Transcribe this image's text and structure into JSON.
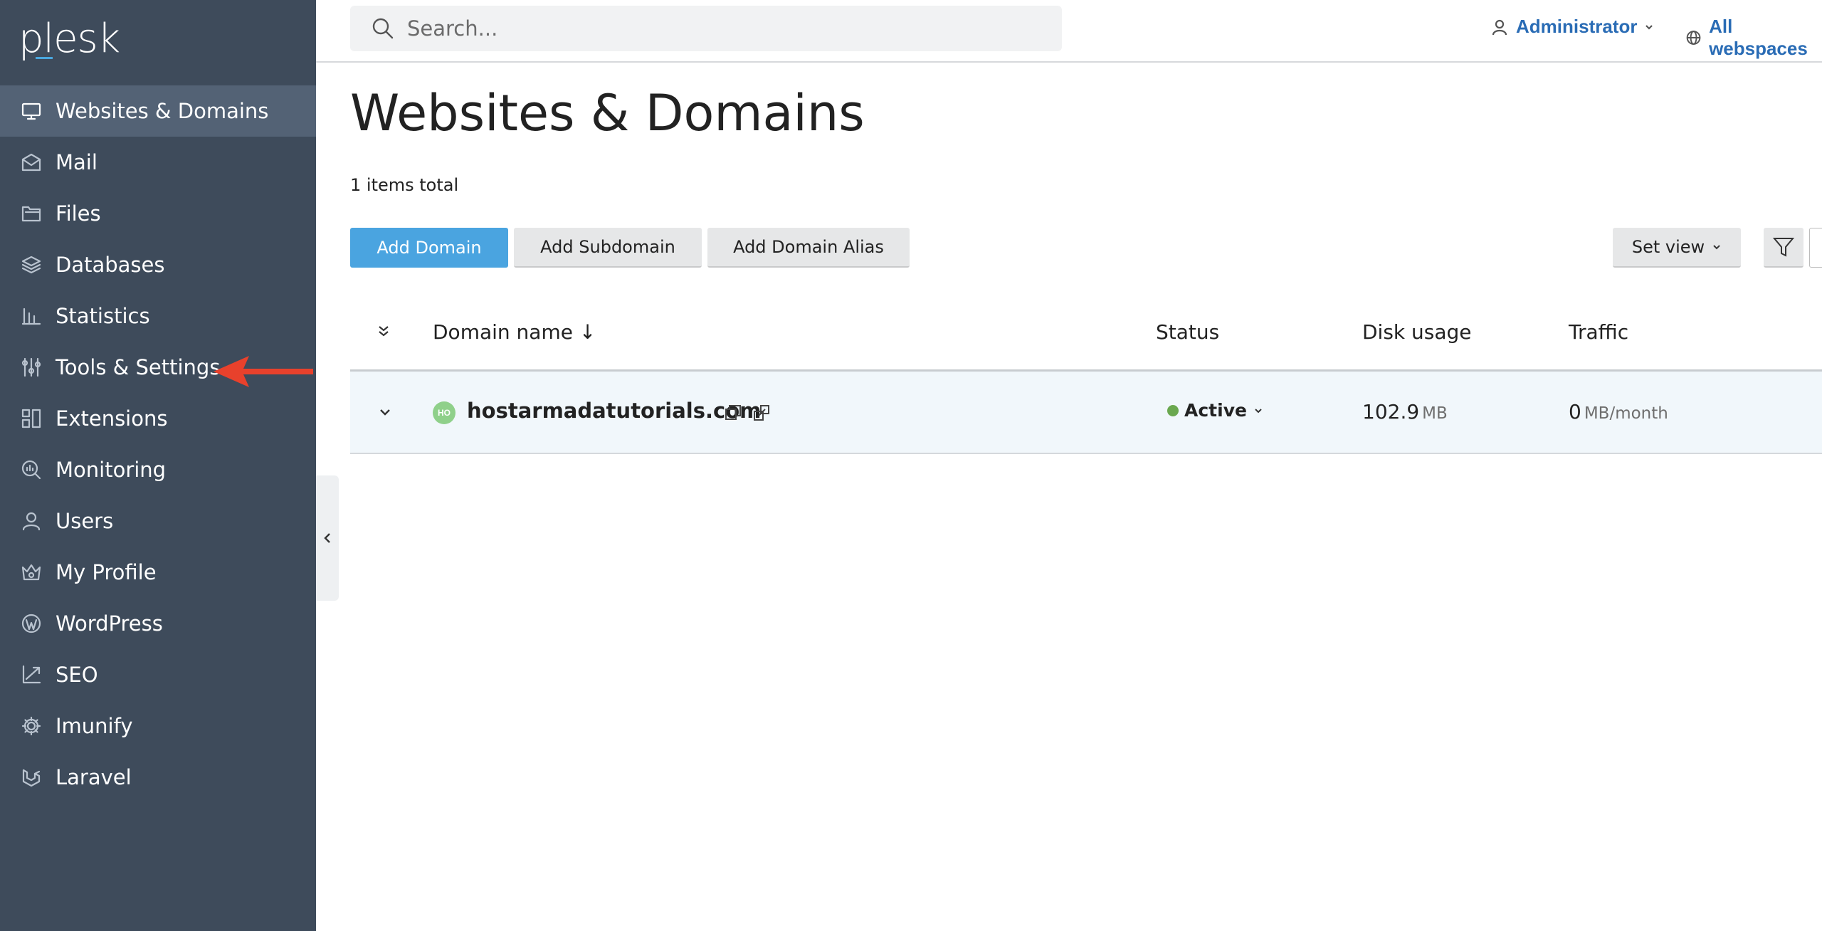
{
  "app": {
    "logo_text": "plesk"
  },
  "sidebar": {
    "items": [
      {
        "label": "Websites & Domains",
        "icon": "monitor-icon",
        "active": true
      },
      {
        "label": "Mail",
        "icon": "mail-icon"
      },
      {
        "label": "Files",
        "icon": "folder-icon"
      },
      {
        "label": "Databases",
        "icon": "layers-icon"
      },
      {
        "label": "Statistics",
        "icon": "bar-chart-icon"
      },
      {
        "label": "Tools & Settings",
        "icon": "sliders-icon"
      },
      {
        "label": "Extensions",
        "icon": "grid-icon"
      },
      {
        "label": "Monitoring",
        "icon": "magnifier-chart-icon"
      },
      {
        "label": "Users",
        "icon": "user-icon"
      },
      {
        "label": "My Profile",
        "icon": "crown-icon"
      },
      {
        "label": "WordPress",
        "icon": "wordpress-icon"
      },
      {
        "label": "SEO",
        "icon": "trend-icon"
      },
      {
        "label": "Imunify",
        "icon": "gear-icon"
      },
      {
        "label": "Laravel",
        "icon": "laravel-icon"
      }
    ]
  },
  "topbar": {
    "search_placeholder": "Search...",
    "user_label": "Administrator",
    "webspaces_label": "All webspaces"
  },
  "main": {
    "title": "Websites & Domains",
    "items_total": "1 items total",
    "buttons": {
      "add_domain": "Add Domain",
      "add_subdomain": "Add Subdomain",
      "add_alias": "Add Domain Alias",
      "set_view": "Set view"
    },
    "table": {
      "headers": {
        "domain_name": "Domain name ↓",
        "status": "Status",
        "disk_usage": "Disk usage",
        "traffic": "Traffic"
      },
      "rows": [
        {
          "favicon_text": "HO",
          "domain": "hostarmadatutorials.com",
          "status": "Active",
          "disk_value": "102.9",
          "disk_unit": "MB",
          "traffic_value": "0",
          "traffic_unit": "MB/month"
        }
      ]
    }
  },
  "colors": {
    "sidebar_bg": "#3e4b5b",
    "sidebar_active": "#536275",
    "primary_button": "#4aa4e0",
    "status_active": "#6aa84f",
    "arrow": "#e8412c"
  }
}
